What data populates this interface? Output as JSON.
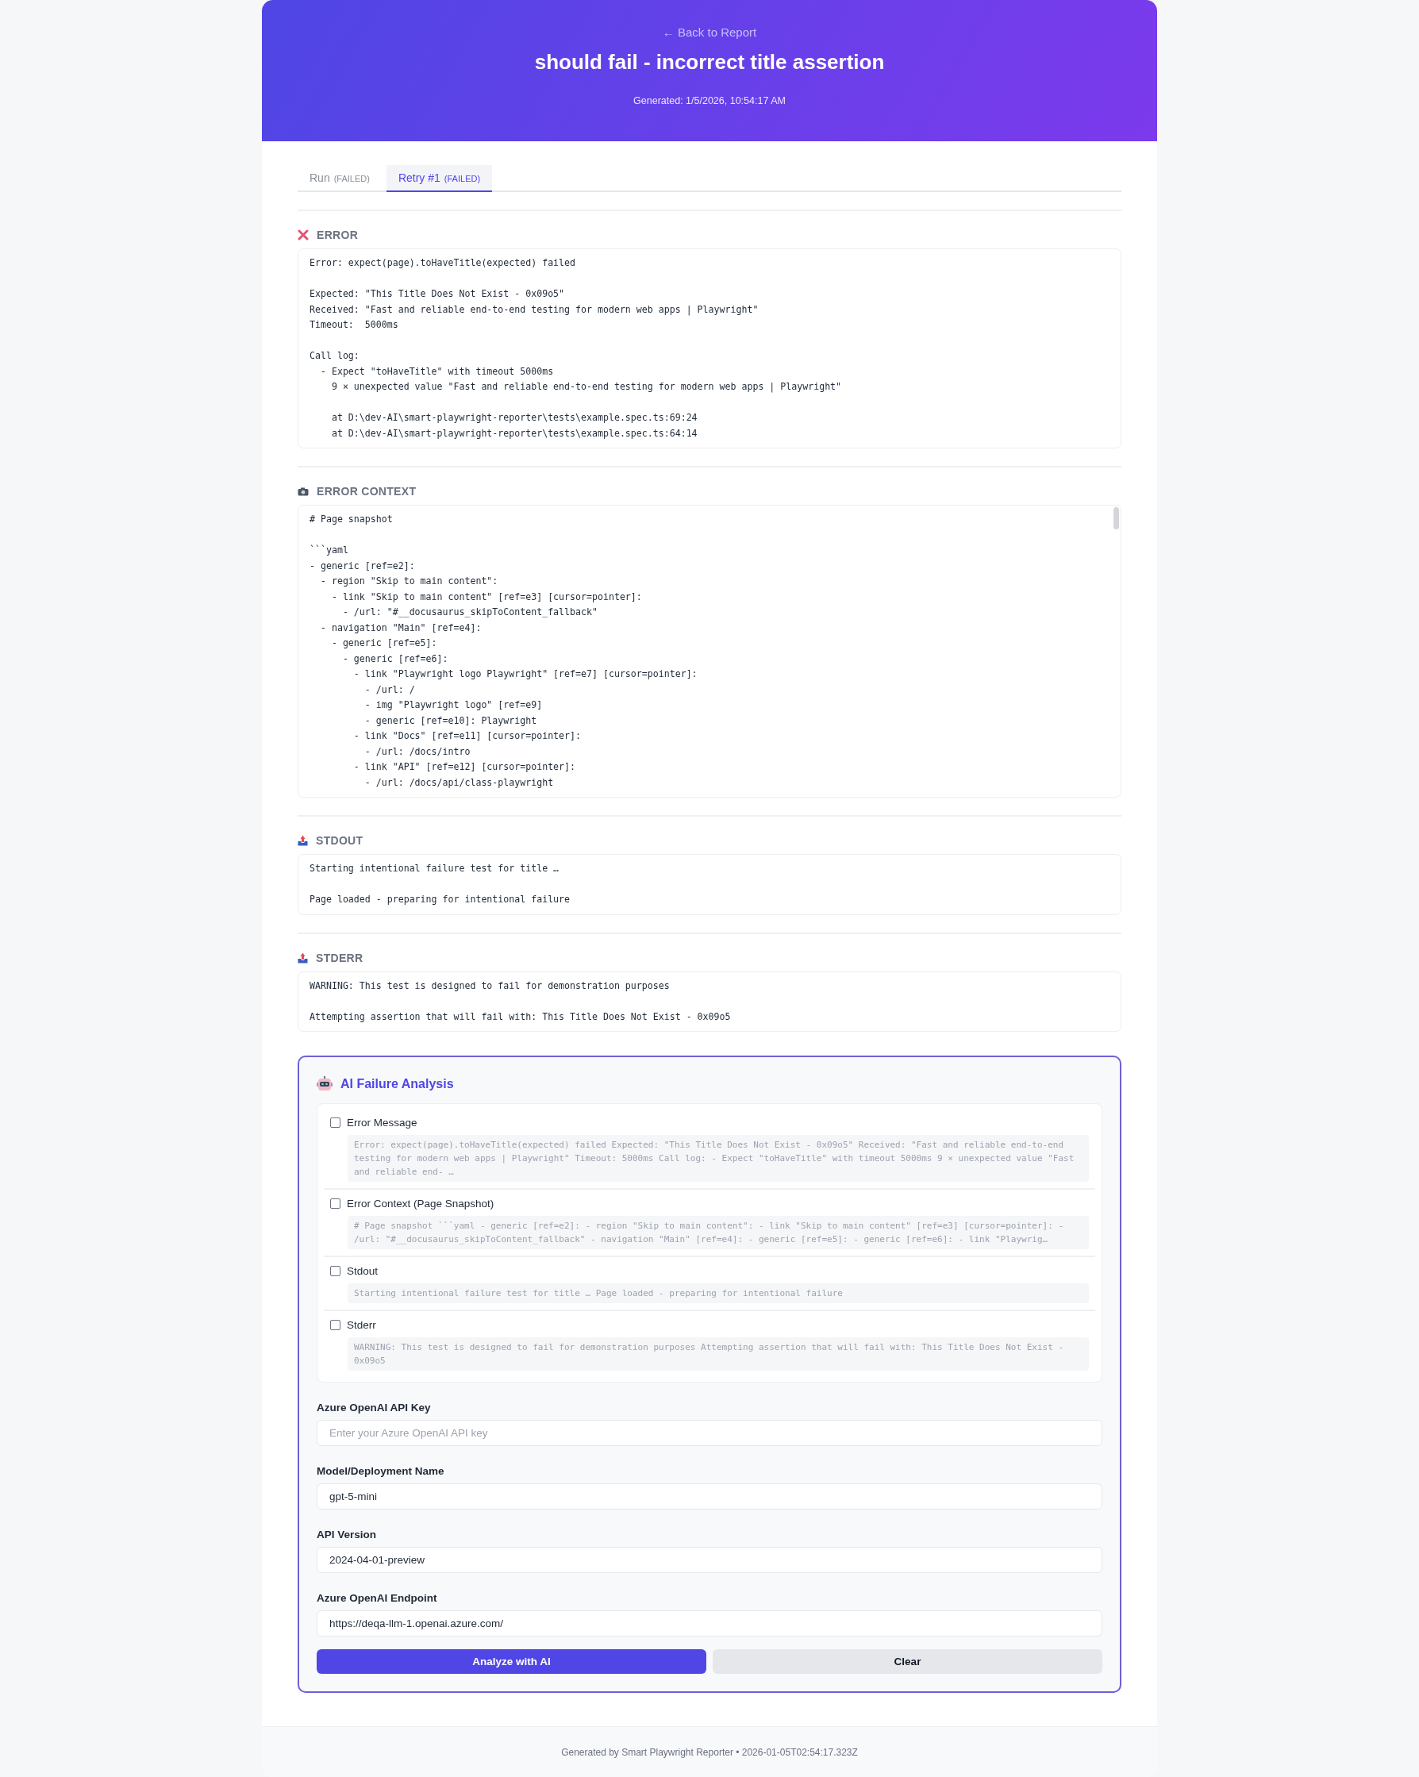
{
  "header": {
    "back_link": "← Back to Report",
    "title": "should fail - incorrect title assertion",
    "generated": "Generated: 1/5/2026, 10:54:17 AM"
  },
  "tabs": [
    {
      "label": "Run",
      "status": "(FAILED)",
      "selected": false
    },
    {
      "label": "Retry #1",
      "status": "(FAILED)",
      "selected": true
    }
  ],
  "sections": [
    {
      "kind": "error",
      "title": "ERROR",
      "scrollable": false,
      "text": "Error: expect(page).toHaveTitle(expected) failed\n\nExpected: \"This Title Does Not Exist - 0x09o5\"\nReceived: \"Fast and reliable end-to-end testing for modern web apps | Playwright\"\nTimeout:  5000ms\n\nCall log:\n  - Expect \"toHaveTitle\" with timeout 5000ms\n    9 × unexpected value \"Fast and reliable end-to-end testing for modern web apps | Playwright\"\n\n    at D:\\dev-AI\\smart-playwright-reporter\\tests\\example.spec.ts:69:24\n    at D:\\dev-AI\\smart-playwright-reporter\\tests\\example.spec.ts:64:14"
    },
    {
      "kind": "context",
      "title": "ERROR CONTEXT",
      "scrollable": true,
      "text": "# Page snapshot\n\n```yaml\n- generic [ref=e2]:\n  - region \"Skip to main content\":\n    - link \"Skip to main content\" [ref=e3] [cursor=pointer]:\n      - /url: \"#__docusaurus_skipToContent_fallback\"\n  - navigation \"Main\" [ref=e4]:\n    - generic [ref=e5]:\n      - generic [ref=e6]:\n        - link \"Playwright logo Playwright\" [ref=e7] [cursor=pointer]:\n          - /url: /\n          - img \"Playwright logo\" [ref=e9]\n          - generic [ref=e10]: Playwright\n        - link \"Docs\" [ref=e11] [cursor=pointer]:\n          - /url: /docs/intro\n        - link \"API\" [ref=e12] [cursor=pointer]:\n          - /url: /docs/api/class-playwright"
    },
    {
      "kind": "stdout",
      "title": "STDOUT",
      "scrollable": false,
      "text": "Starting intentional failure test for title …\n\nPage loaded - preparing for intentional failure"
    },
    {
      "kind": "stderr",
      "title": "STDERR",
      "scrollable": false,
      "text": "WARNING: This test is designed to fail for demonstration purposes\n\nAttempting assertion that will fail with: This Title Does Not Exist - 0x09o5"
    }
  ],
  "ai_analysis": {
    "title": "AI Failure Analysis",
    "sources": [
      {
        "label": "Error Message",
        "checked": false,
        "preview": "Error: expect(page).toHaveTitle(expected) failed Expected: \"This Title Does Not Exist - 0x09o5\" Received: \"Fast and reliable end-to-end testing for modern web apps | Playwright\" Timeout: 5000ms Call log: - Expect \"toHaveTitle\" with timeout 5000ms 9 × unexpected value \"Fast and reliable end- …"
      },
      {
        "label": "Error Context (Page Snapshot)",
        "checked": false,
        "preview": "# Page snapshot ```yaml - generic [ref=e2]: - region \"Skip to main content\": - link \"Skip to main content\" [ref=e3] [cursor=pointer]: - /url: \"#__docusaurus_skipToContent_fallback\" - navigation \"Main\" [ref=e4]: - generic [ref=e5]: - generic [ref=e6]: - link \"Playwrig…"
      },
      {
        "label": "Stdout",
        "checked": false,
        "preview": "Starting intentional failure test for title … Page loaded - preparing for intentional failure"
      },
      {
        "label": "Stderr",
        "checked": false,
        "preview": "WARNING: This test is designed to fail for demonstration purposes Attempting assertion that will fail with: This Title Does Not Exist - 0x09o5"
      }
    ],
    "fields": [
      {
        "label": "Azure OpenAI API Key",
        "placeholder": "Enter your Azure OpenAI API key"
      },
      {
        "label": "Model/Deployment Name",
        "value": "gpt-5-mini"
      },
      {
        "label": "API Version",
        "value": "2024-04-01-preview"
      },
      {
        "label": "Azure OpenAI Endpoint",
        "value": "https://deqa-llm-1.openai.azure.com/"
      }
    ],
    "buttons": [
      {
        "label": "Analyze with AI",
        "kind": "primary"
      },
      {
        "label": "Clear",
        "kind": "secondary"
      }
    ]
  },
  "footer": "Generated by Smart Playwright Reporter • 2026-01-05T02:54:17.323Z"
}
